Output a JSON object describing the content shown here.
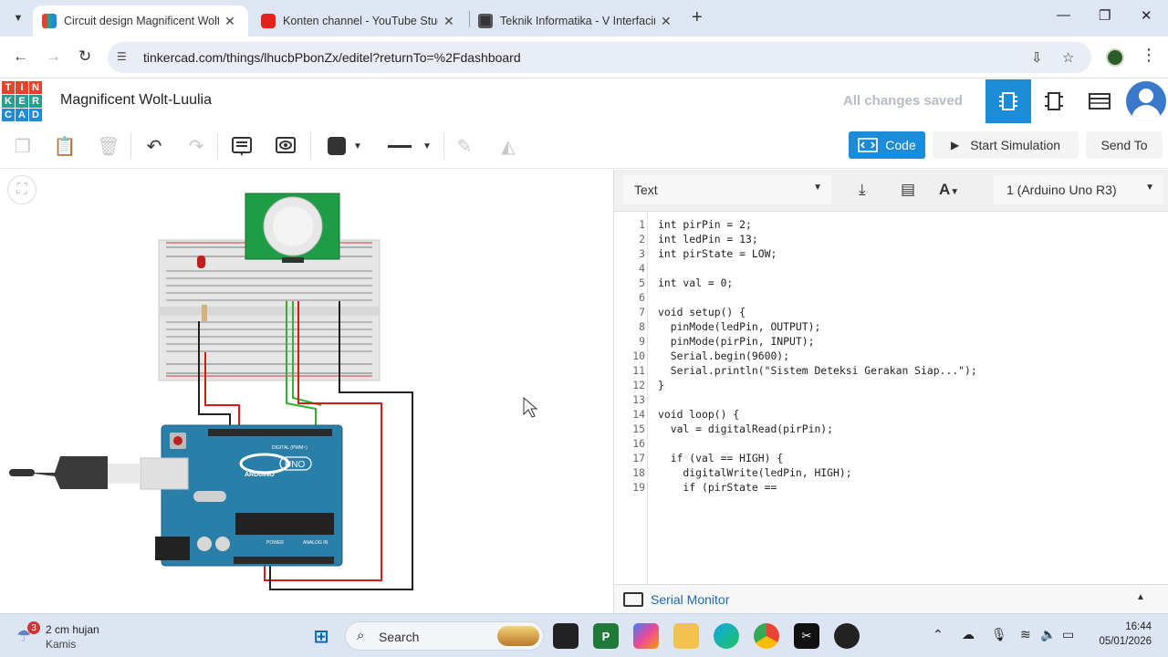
{
  "browser": {
    "tabs": [
      {
        "title": "Circuit design Magnificent Wolt",
        "active": true
      },
      {
        "title": "Konten channel - YouTube Studi",
        "active": false
      },
      {
        "title": "Teknik Informatika - V Interfacin",
        "active": false
      }
    ],
    "url": "tinkercad.com/things/lhucbPbonZx/editel?returnTo=%2Fdashboard"
  },
  "header": {
    "logo_letters": [
      "T",
      "I",
      "N",
      "K",
      "E",
      "R",
      "C",
      "A",
      "D"
    ],
    "project_title": "Magnificent Wolt-Luulia",
    "save_status": "All changes saved"
  },
  "toolbar": {
    "code_label": "Code",
    "sim_label": "Start Simulation",
    "send_label": "Send To"
  },
  "code_panel": {
    "mode": "Text",
    "board": "1 (Arduino Uno R3)",
    "lines": [
      "int pirPin = 2;",
      "int ledPin = 13;",
      "int pirState = LOW;",
      "",
      "int val = 0;",
      "",
      "void setup() {",
      "  pinMode(ledPin, OUTPUT);",
      "  pinMode(pirPin, INPUT);",
      "  Serial.begin(9600);",
      "  Serial.println(\"Sistem Deteksi Gerakan Siap...\");",
      "}",
      "",
      "void loop() {",
      "  val = digitalRead(pirPin);",
      "",
      "  if (val == HIGH) {",
      "    digitalWrite(ledPin, HIGH);",
      "    if (pirState =="
    ],
    "serial_monitor_label": "Serial Monitor"
  },
  "circuit": {
    "pir_label": "PIR",
    "arduino_label": "ARDUINO",
    "uno_label": "UNO",
    "digital_label": "DIGITAL (PWM~)",
    "power_label": "POWER",
    "analog_label": "ANALOG IN"
  },
  "taskbar": {
    "weather_temp": "2 cm hujan",
    "weather_day": "Kamis",
    "notification_count": "3",
    "search_label": "Search",
    "time": "16:44",
    "date": "05/01/2026"
  }
}
